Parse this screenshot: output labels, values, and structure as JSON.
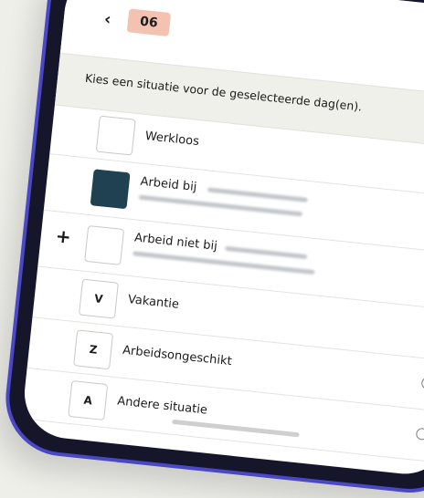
{
  "header": {
    "back_icon": "chevron-left-icon",
    "day": "06"
  },
  "info": {
    "text": "Kies een situatie voor de geselecteerde dag(en).",
    "arrow_icon": "chevron-right-icon"
  },
  "situations": [
    {
      "code": "",
      "label": "Werkloos",
      "selected": false
    },
    {
      "code": "",
      "label": "Arbeid bij",
      "selected": false
    },
    {
      "code": "",
      "label": "Arbeid niet bij",
      "selected": true,
      "prefix": "+"
    },
    {
      "code": "V",
      "label": "Vakantie",
      "selected": false
    },
    {
      "code": "Z",
      "label": "Arbeidsongeschikt",
      "selected": false
    },
    {
      "code": "A",
      "label": "Andere situatie",
      "selected": false
    }
  ],
  "colors": {
    "badge": "#f3c2b1",
    "accent_dark": "#1f4152",
    "frame": "#4a48c6"
  }
}
